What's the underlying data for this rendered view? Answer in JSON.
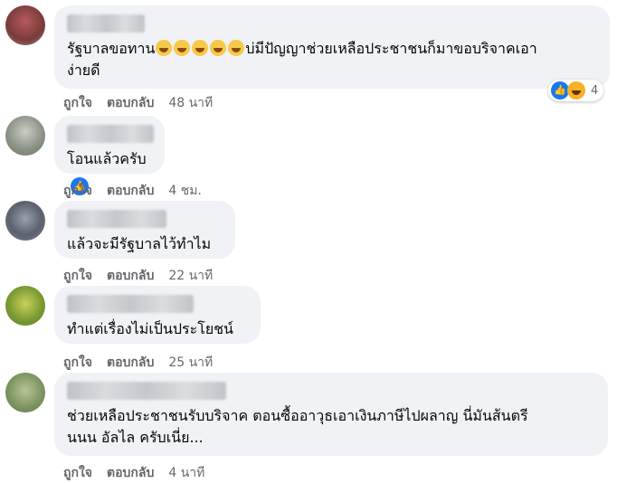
{
  "comments": [
    {
      "text_before_emoji": "รัฐบาลขอทาน",
      "emoji_count": 5,
      "text_after_emoji": "บ่มีปัญญาช่วยเหลือประชาชนก็มาขอบริจาคเอา",
      "text_line2": "ง่ายดี",
      "like_label": "ถูกใจ",
      "reply_label": "ตอบกลับ",
      "time": "48 นาที",
      "reaction_count": "4",
      "reaction_icons": [
        "like-icon",
        "haha-icon"
      ]
    },
    {
      "text": "โอนแล้วครับ",
      "inline_icon": "like-icon",
      "like_label": "ถูกใจ",
      "reply_label": "ตอบกลับ",
      "time": "4 ชม."
    },
    {
      "text": "แล้วจะมีรัฐบาลไว้ทำไม",
      "like_label": "ถูกใจ",
      "reply_label": "ตอบกลับ",
      "time": "22 นาที"
    },
    {
      "text": "ทำแต่เรื่องไม่เป็นประโยชน์",
      "like_label": "ถูกใจ",
      "reply_label": "ตอบกลับ",
      "time": "25 นาที"
    },
    {
      "text_line1": "ช่วยเหลือประชาชนรับบริจาค ตอนซื้ออาวุธเอาเงินภาษีไปผลาญ นี่มันส้นตรี",
      "text_line2": "นนน อัลไล ครับเนี่ย...",
      "like_label": "ถูกใจ",
      "reply_label": "ตอบกลับ",
      "time": "4 นาที"
    }
  ],
  "colors": {
    "bubble": "#f0f2f5",
    "secondary_text": "#65676b",
    "like_blue": "#1877f2",
    "haha_yellow": "#f7b125"
  }
}
